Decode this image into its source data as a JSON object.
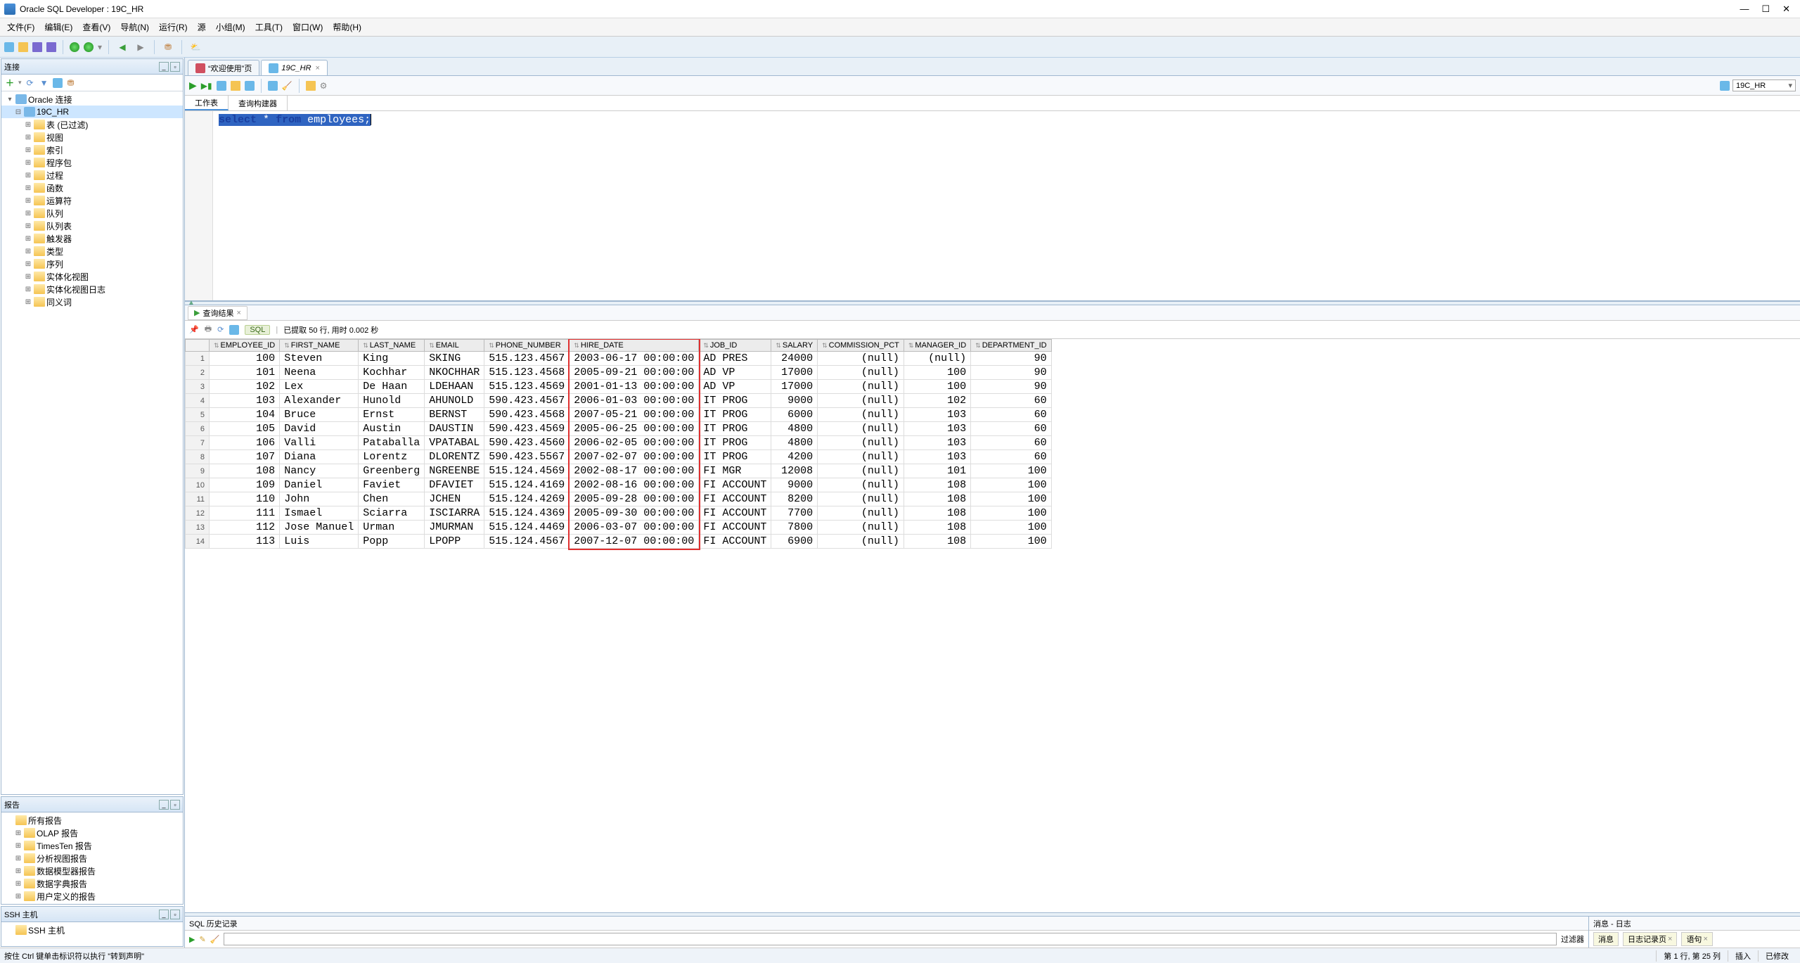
{
  "title": "Oracle SQL Developer : 19C_HR",
  "menu": [
    "文件(F)",
    "编辑(E)",
    "查看(V)",
    "导航(N)",
    "运行(R)",
    "源",
    "小组(M)",
    "工具(T)",
    "窗口(W)",
    "帮助(H)"
  ],
  "left_panels": {
    "connections": {
      "title": "连接",
      "root": "Oracle 连接",
      "db": "19C_HR",
      "nodes": [
        "表 (已过滤)",
        "视图",
        "索引",
        "程序包",
        "过程",
        "函数",
        "运算符",
        "队列",
        "队列表",
        "触发器",
        "类型",
        "序列",
        "实体化视图",
        "实体化视图日志",
        "同义词"
      ]
    },
    "reports": {
      "title": "报告",
      "root": "所有报告",
      "items": [
        "OLAP 报告",
        "TimesTen 报告",
        "分析视图报告",
        "数据模型器报告",
        "数据字典报告",
        "用户定义的报告"
      ]
    },
    "ssh": {
      "title": "SSH 主机",
      "root": "SSH 主机"
    }
  },
  "tabs": {
    "welcome": "“欢迎使用”页",
    "main": "19C_HR"
  },
  "conn_selector": "19C_HR",
  "sub_tabs": {
    "worksheet": "工作表",
    "builder": "查询构建器"
  },
  "sql": {
    "text": "select * from employees;",
    "kw1": "select",
    "star": "*",
    "kw2": "from",
    "tbl": "employees",
    "semi": ";"
  },
  "results": {
    "tab": "查询结果",
    "sql_chip": "SQL",
    "status": "已提取 50 行, 用时 0.002 秒",
    "columns": [
      "EMPLOYEE_ID",
      "FIRST_NAME",
      "LAST_NAME",
      "EMAIL",
      "PHONE_NUMBER",
      "HIRE_DATE",
      "JOB_ID",
      "SALARY",
      "COMMISSION_PCT",
      "MANAGER_ID",
      "DEPARTMENT_ID"
    ],
    "rows": [
      {
        "n": 1,
        "id": 100,
        "fn": "Steven",
        "ln": "King",
        "em": "SKING",
        "ph": "515.123.4567",
        "hd": "2003-06-17 00:00:00",
        "job": "AD PRES",
        "sal": 24000,
        "cp": "(null)",
        "mgr": "(null)",
        "dep": 90
      },
      {
        "n": 2,
        "id": 101,
        "fn": "Neena",
        "ln": "Kochhar",
        "em": "NKOCHHAR",
        "ph": "515.123.4568",
        "hd": "2005-09-21 00:00:00",
        "job": "AD VP",
        "sal": 17000,
        "cp": "(null)",
        "mgr": 100,
        "dep": 90
      },
      {
        "n": 3,
        "id": 102,
        "fn": "Lex",
        "ln": "De Haan",
        "em": "LDEHAAN",
        "ph": "515.123.4569",
        "hd": "2001-01-13 00:00:00",
        "job": "AD VP",
        "sal": 17000,
        "cp": "(null)",
        "mgr": 100,
        "dep": 90
      },
      {
        "n": 4,
        "id": 103,
        "fn": "Alexander",
        "ln": "Hunold",
        "em": "AHUNOLD",
        "ph": "590.423.4567",
        "hd": "2006-01-03 00:00:00",
        "job": "IT PROG",
        "sal": 9000,
        "cp": "(null)",
        "mgr": 102,
        "dep": 60
      },
      {
        "n": 5,
        "id": 104,
        "fn": "Bruce",
        "ln": "Ernst",
        "em": "BERNST",
        "ph": "590.423.4568",
        "hd": "2007-05-21 00:00:00",
        "job": "IT PROG",
        "sal": 6000,
        "cp": "(null)",
        "mgr": 103,
        "dep": 60
      },
      {
        "n": 6,
        "id": 105,
        "fn": "David",
        "ln": "Austin",
        "em": "DAUSTIN",
        "ph": "590.423.4569",
        "hd": "2005-06-25 00:00:00",
        "job": "IT PROG",
        "sal": 4800,
        "cp": "(null)",
        "mgr": 103,
        "dep": 60
      },
      {
        "n": 7,
        "id": 106,
        "fn": "Valli",
        "ln": "Pataballa",
        "em": "VPATABAL",
        "ph": "590.423.4560",
        "hd": "2006-02-05 00:00:00",
        "job": "IT PROG",
        "sal": 4800,
        "cp": "(null)",
        "mgr": 103,
        "dep": 60
      },
      {
        "n": 8,
        "id": 107,
        "fn": "Diana",
        "ln": "Lorentz",
        "em": "DLORENTZ",
        "ph": "590.423.5567",
        "hd": "2007-02-07 00:00:00",
        "job": "IT PROG",
        "sal": 4200,
        "cp": "(null)",
        "mgr": 103,
        "dep": 60
      },
      {
        "n": 9,
        "id": 108,
        "fn": "Nancy",
        "ln": "Greenberg",
        "em": "NGREENBE",
        "ph": "515.124.4569",
        "hd": "2002-08-17 00:00:00",
        "job": "FI MGR",
        "sal": 12008,
        "cp": "(null)",
        "mgr": 101,
        "dep": 100
      },
      {
        "n": 10,
        "id": 109,
        "fn": "Daniel",
        "ln": "Faviet",
        "em": "DFAVIET",
        "ph": "515.124.4169",
        "hd": "2002-08-16 00:00:00",
        "job": "FI ACCOUNT",
        "sal": 9000,
        "cp": "(null)",
        "mgr": 108,
        "dep": 100
      },
      {
        "n": 11,
        "id": 110,
        "fn": "John",
        "ln": "Chen",
        "em": "JCHEN",
        "ph": "515.124.4269",
        "hd": "2005-09-28 00:00:00",
        "job": "FI ACCOUNT",
        "sal": 8200,
        "cp": "(null)",
        "mgr": 108,
        "dep": 100
      },
      {
        "n": 12,
        "id": 111,
        "fn": "Ismael",
        "ln": "Sciarra",
        "em": "ISCIARRA",
        "ph": "515.124.4369",
        "hd": "2005-09-30 00:00:00",
        "job": "FI ACCOUNT",
        "sal": 7700,
        "cp": "(null)",
        "mgr": 108,
        "dep": 100
      },
      {
        "n": 13,
        "id": 112,
        "fn": "Jose Manuel",
        "ln": "Urman",
        "em": "JMURMAN",
        "ph": "515.124.4469",
        "hd": "2006-03-07 00:00:00",
        "job": "FI ACCOUNT",
        "sal": 7800,
        "cp": "(null)",
        "mgr": 108,
        "dep": 100
      },
      {
        "n": 14,
        "id": 113,
        "fn": "Luis",
        "ln": "Popp",
        "em": "LPOPP",
        "ph": "515.124.4567",
        "hd": "2007-12-07 00:00:00",
        "job": "FI ACCOUNT",
        "sal": 6900,
        "cp": "(null)",
        "mgr": 108,
        "dep": 100
      }
    ]
  },
  "bottom": {
    "history": "SQL 历史记录",
    "filter": "过滤器",
    "messages_title": "消息 - 日志",
    "msg_tab1": "消息",
    "msg_tab2": "日志记录页",
    "msg_tab3": "语句"
  },
  "status": {
    "hint": "按住 Ctrl 键单击标识符以执行 \"转到声明\"",
    "pos": "第 1 行, 第 25 列",
    "ins": "插入",
    "mod": "已修改"
  }
}
